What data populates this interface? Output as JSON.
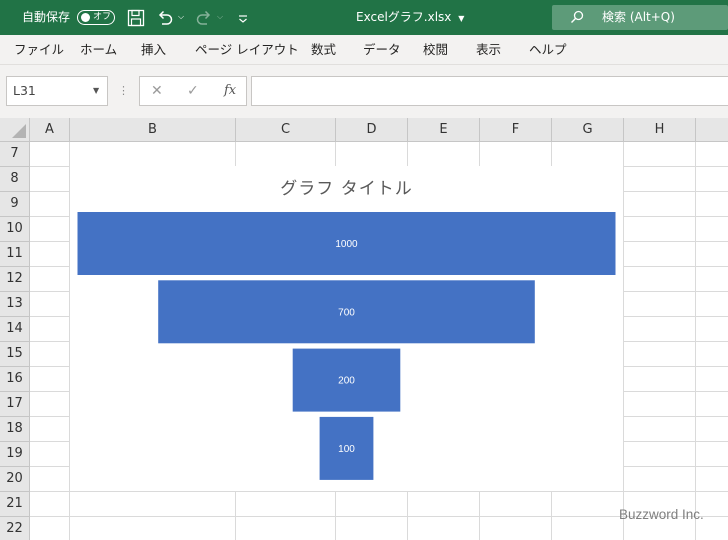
{
  "titlebar": {
    "autosave_label": "自動保存",
    "autosave_state": "オフ",
    "doc_title": "Excelグラフ.xlsx",
    "search_label": "検索 (Alt+Q)"
  },
  "ribbon": {
    "tabs": [
      "ファイル",
      "ホーム",
      "挿入",
      "ページ レイアウト",
      "数式",
      "データ",
      "校閲",
      "表示",
      "ヘルプ"
    ]
  },
  "formula_bar": {
    "name_box": "L31",
    "cancel_symbol": "✕",
    "enter_symbol": "✓",
    "fx_label": "fx",
    "formula": ""
  },
  "grid": {
    "columns": [
      "A",
      "B",
      "C",
      "D",
      "E",
      "F",
      "G",
      "H"
    ],
    "rows": [
      "7",
      "8",
      "9",
      "10",
      "11",
      "12",
      "13",
      "14",
      "15",
      "16",
      "17",
      "18",
      "19",
      "20",
      "21",
      "22"
    ]
  },
  "chart_data": {
    "type": "funnel",
    "title": "グラフ タイトル",
    "values": [
      1000,
      700,
      200,
      100
    ],
    "data_labels": [
      "1000",
      "700",
      "200",
      "100"
    ],
    "bar_color": "#4472c4"
  },
  "watermark": "Buzzword Inc.",
  "colors": {
    "accent": "#217346",
    "bar": "#4472c4"
  }
}
